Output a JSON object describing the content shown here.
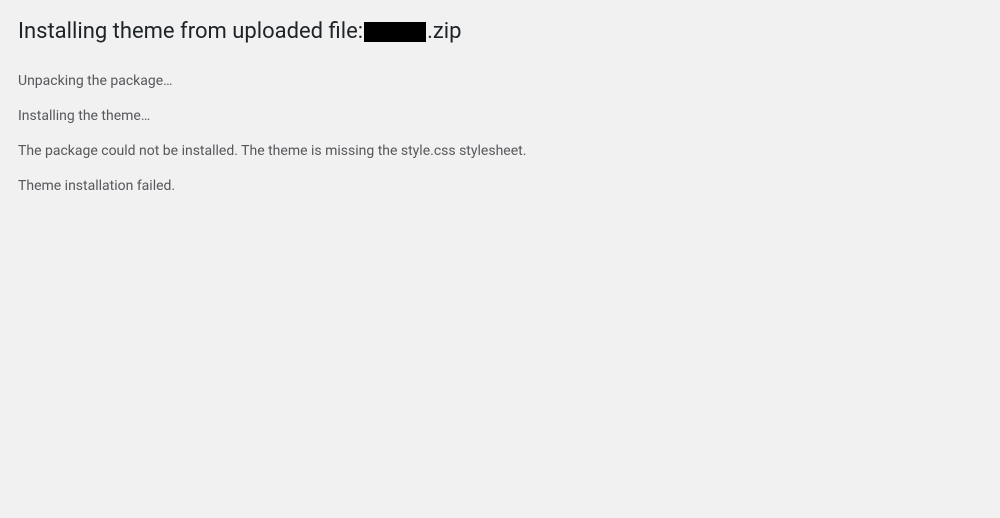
{
  "header": {
    "title_prefix": "Installing theme from uploaded file:",
    "file_extension": ".zip"
  },
  "status": {
    "line1": "Unpacking the package…",
    "line2": "Installing the theme…",
    "line3": "The package could not be installed. The theme is missing the style.css stylesheet.",
    "line4": "Theme installation failed."
  }
}
